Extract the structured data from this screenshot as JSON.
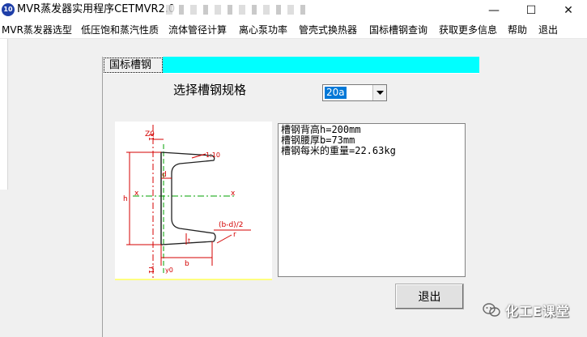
{
  "window": {
    "title": "MVR蒸发器实用程序CETMVR2.0",
    "icon_name": "app-icon",
    "icon_text": "10",
    "controls": {
      "minimize": "—",
      "maximize": "☐",
      "close": "✕"
    }
  },
  "menu": {
    "items": [
      {
        "label": "MVR蒸发器选型"
      },
      {
        "label": "低压饱和蒸汽性质"
      },
      {
        "label": "流体管径计算"
      },
      {
        "label": "离心泵功率"
      },
      {
        "label": "管壳式换热器"
      },
      {
        "label": "国标槽钢查询"
      },
      {
        "label": "获取更多信息"
      },
      {
        "label": "帮助"
      },
      {
        "label": "退出"
      }
    ]
  },
  "dialog": {
    "tab_label": "国标槽钢",
    "tab_color": "#00ffff",
    "select_label": "选择槽钢规格",
    "spec_value": "20a",
    "diagram_labels": {
      "z0": "Z0",
      "slope": "1:10",
      "d": "d",
      "x_left": "x",
      "x_right": "x",
      "h": "h",
      "y_top": "Y1",
      "y_bottom": "Y1",
      "y0": "y0",
      "half_flange": "(b-d)/2",
      "t": "t",
      "b": "b",
      "r": "r"
    },
    "info_lines": [
      "槽钢背高h=200mm",
      "槽钢腰厚b=73mm",
      "槽钢每米的重量=22.63kg"
    ],
    "exit_button": "退出"
  },
  "watermark": {
    "text": "化工E课堂",
    "icon_name": "wechat-icon"
  },
  "colors": {
    "selection": "#0078d7",
    "dimension_red": "#d40000",
    "centerline_green": "#00a000"
  }
}
